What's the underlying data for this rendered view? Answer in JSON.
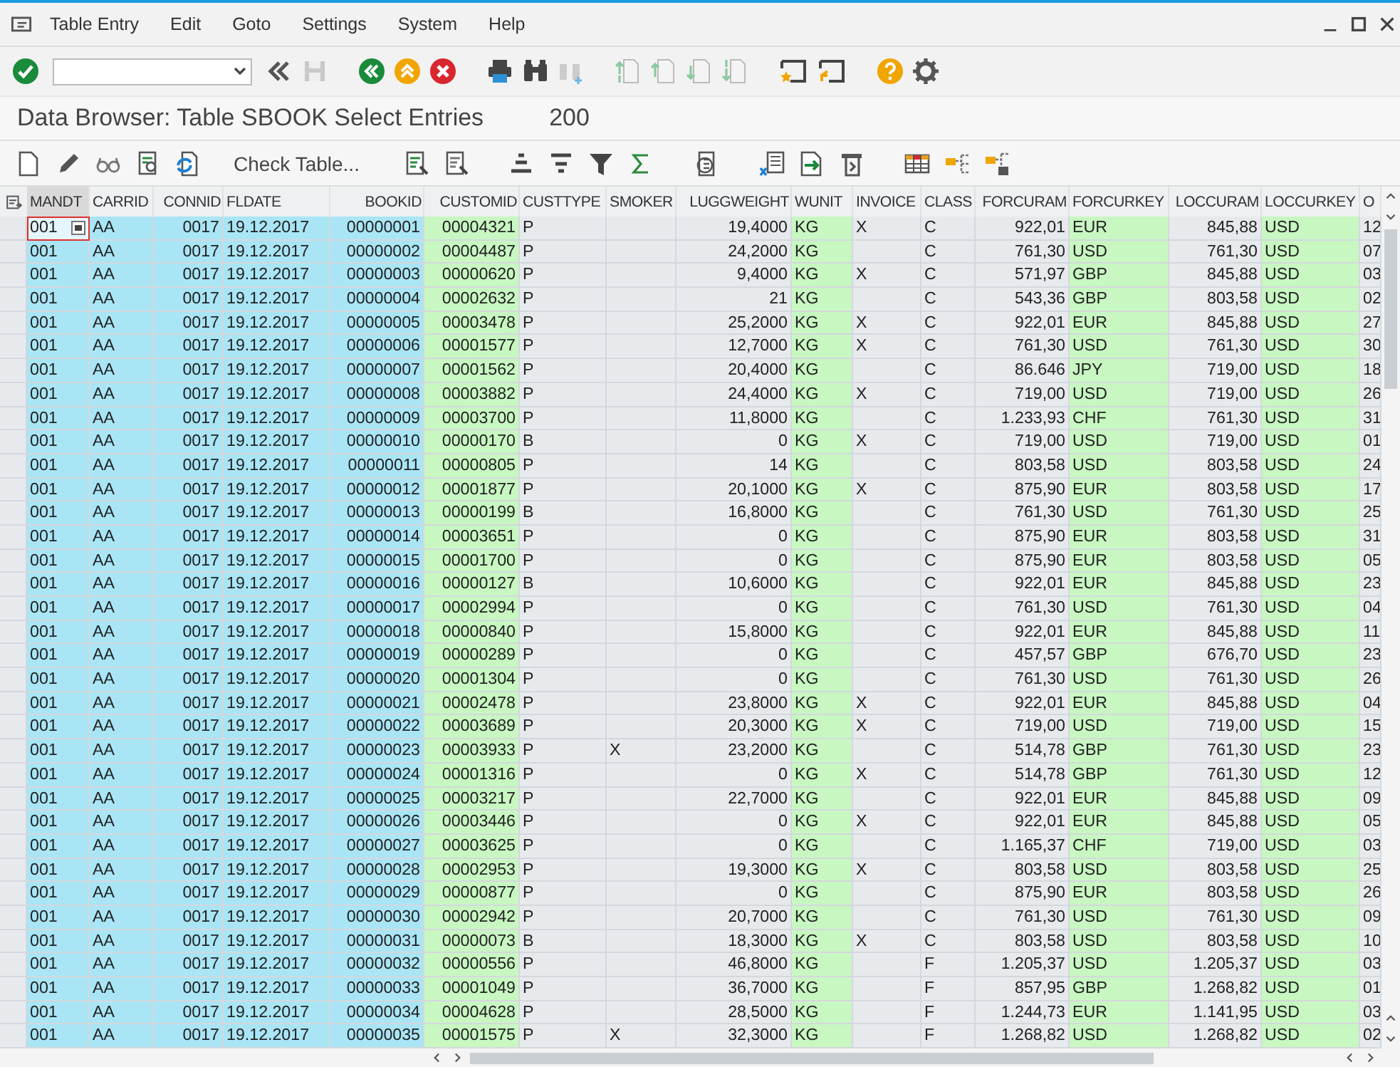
{
  "menu_bar": {
    "items": [
      "Table Entry",
      "Edit",
      "Goto",
      "Settings",
      "System",
      "Help"
    ]
  },
  "title": {
    "text": "Data Browser: Table SBOOK Select Entries",
    "count": "200"
  },
  "app_toolbar": {
    "check_table_button": "Check Table..."
  },
  "table": {
    "columns": [
      {
        "label": "MANDT",
        "kind": "key",
        "numeric": false
      },
      {
        "label": "CARRID",
        "kind": "key",
        "numeric": false
      },
      {
        "label": "CONNID",
        "kind": "key",
        "numeric": true
      },
      {
        "label": "FLDATE",
        "kind": "key",
        "numeric": false
      },
      {
        "label": "BOOKID",
        "kind": "key",
        "numeric": true
      },
      {
        "label": "CUSTOMID",
        "kind": "ref",
        "numeric": true
      },
      {
        "label": "CUSTTYPE",
        "kind": "data",
        "numeric": false
      },
      {
        "label": "SMOKER",
        "kind": "data",
        "numeric": false
      },
      {
        "label": "LUGGWEIGHT",
        "kind": "data",
        "numeric": true
      },
      {
        "label": "WUNIT",
        "kind": "ref",
        "numeric": false
      },
      {
        "label": "INVOICE",
        "kind": "data",
        "numeric": false
      },
      {
        "label": "CLASS",
        "kind": "data",
        "numeric": false
      },
      {
        "label": "FORCURAM",
        "kind": "data",
        "numeric": true
      },
      {
        "label": "FORCURKEY",
        "kind": "ref",
        "numeric": false
      },
      {
        "label": "LOCCURAM",
        "kind": "data",
        "numeric": true
      },
      {
        "label": "LOCCURKEY",
        "kind": "ref",
        "numeric": false
      },
      {
        "label": "O",
        "kind": "data",
        "numeric": false
      }
    ],
    "rows": [
      {
        "focused": true,
        "cells": [
          "001",
          "AA",
          "0017",
          "19.12.2017",
          "00000001",
          "00004321",
          "P",
          null,
          "19,4000",
          "KG",
          "X",
          "C",
          "922,01",
          "EUR",
          "845,88",
          "USD",
          "12"
        ]
      },
      {
        "focused": false,
        "cells": [
          "001",
          "AA",
          "0017",
          "19.12.2017",
          "00000002",
          "00004487",
          "P",
          null,
          "24,2000",
          "KG",
          null,
          "C",
          "761,30",
          "USD",
          "761,30",
          "USD",
          "07"
        ]
      },
      {
        "focused": false,
        "cells": [
          "001",
          "AA",
          "0017",
          "19.12.2017",
          "00000003",
          "00000620",
          "P",
          null,
          "9,4000",
          "KG",
          "X",
          "C",
          "571,97",
          "GBP",
          "845,88",
          "USD",
          "03"
        ]
      },
      {
        "focused": false,
        "cells": [
          "001",
          "AA",
          "0017",
          "19.12.2017",
          "00000004",
          "00002632",
          "P",
          null,
          "21",
          "KG",
          null,
          "C",
          "543,36",
          "GBP",
          "803,58",
          "USD",
          "02"
        ]
      },
      {
        "focused": false,
        "cells": [
          "001",
          "AA",
          "0017",
          "19.12.2017",
          "00000005",
          "00003478",
          "P",
          null,
          "25,2000",
          "KG",
          "X",
          "C",
          "922,01",
          "EUR",
          "845,88",
          "USD",
          "27"
        ]
      },
      {
        "focused": false,
        "cells": [
          "001",
          "AA",
          "0017",
          "19.12.2017",
          "00000006",
          "00001577",
          "P",
          null,
          "12,7000",
          "KG",
          "X",
          "C",
          "761,30",
          "USD",
          "761,30",
          "USD",
          "30"
        ]
      },
      {
        "focused": false,
        "cells": [
          "001",
          "AA",
          "0017",
          "19.12.2017",
          "00000007",
          "00001562",
          "P",
          null,
          "20,4000",
          "KG",
          null,
          "C",
          "86.646",
          "JPY",
          "719,00",
          "USD",
          "18"
        ]
      },
      {
        "focused": false,
        "cells": [
          "001",
          "AA",
          "0017",
          "19.12.2017",
          "00000008",
          "00003882",
          "P",
          null,
          "24,4000",
          "KG",
          "X",
          "C",
          "719,00",
          "USD",
          "719,00",
          "USD",
          "26"
        ]
      },
      {
        "focused": false,
        "cells": [
          "001",
          "AA",
          "0017",
          "19.12.2017",
          "00000009",
          "00003700",
          "P",
          null,
          "11,8000",
          "KG",
          null,
          "C",
          "1.233,93",
          "CHF",
          "761,30",
          "USD",
          "31"
        ]
      },
      {
        "focused": false,
        "cells": [
          "001",
          "AA",
          "0017",
          "19.12.2017",
          "00000010",
          "00000170",
          "B",
          null,
          "0",
          "KG",
          "X",
          "C",
          "719,00",
          "USD",
          "719,00",
          "USD",
          "01"
        ]
      },
      {
        "focused": false,
        "cells": [
          "001",
          "AA",
          "0017",
          "19.12.2017",
          "00000011",
          "00000805",
          "P",
          null,
          "14",
          "KG",
          null,
          "C",
          "803,58",
          "USD",
          "803,58",
          "USD",
          "24"
        ]
      },
      {
        "focused": false,
        "cells": [
          "001",
          "AA",
          "0017",
          "19.12.2017",
          "00000012",
          "00001877",
          "P",
          null,
          "20,1000",
          "KG",
          "X",
          "C",
          "875,90",
          "EUR",
          "803,58",
          "USD",
          "17"
        ]
      },
      {
        "focused": false,
        "cells": [
          "001",
          "AA",
          "0017",
          "19.12.2017",
          "00000013",
          "00000199",
          "B",
          null,
          "16,8000",
          "KG",
          null,
          "C",
          "761,30",
          "USD",
          "761,30",
          "USD",
          "25"
        ]
      },
      {
        "focused": false,
        "cells": [
          "001",
          "AA",
          "0017",
          "19.12.2017",
          "00000014",
          "00003651",
          "P",
          null,
          "0",
          "KG",
          null,
          "C",
          "875,90",
          "EUR",
          "803,58",
          "USD",
          "31"
        ]
      },
      {
        "focused": false,
        "cells": [
          "001",
          "AA",
          "0017",
          "19.12.2017",
          "00000015",
          "00001700",
          "P",
          null,
          "0",
          "KG",
          null,
          "C",
          "875,90",
          "EUR",
          "803,58",
          "USD",
          "05"
        ]
      },
      {
        "focused": false,
        "cells": [
          "001",
          "AA",
          "0017",
          "19.12.2017",
          "00000016",
          "00000127",
          "B",
          null,
          "10,6000",
          "KG",
          null,
          "C",
          "922,01",
          "EUR",
          "845,88",
          "USD",
          "23"
        ]
      },
      {
        "focused": false,
        "cells": [
          "001",
          "AA",
          "0017",
          "19.12.2017",
          "00000017",
          "00002994",
          "P",
          null,
          "0",
          "KG",
          null,
          "C",
          "761,30",
          "USD",
          "761,30",
          "USD",
          "04"
        ]
      },
      {
        "focused": false,
        "cells": [
          "001",
          "AA",
          "0017",
          "19.12.2017",
          "00000018",
          "00000840",
          "P",
          null,
          "15,8000",
          "KG",
          null,
          "C",
          "922,01",
          "EUR",
          "845,88",
          "USD",
          "11"
        ]
      },
      {
        "focused": false,
        "cells": [
          "001",
          "AA",
          "0017",
          "19.12.2017",
          "00000019",
          "00000289",
          "P",
          null,
          "0",
          "KG",
          null,
          "C",
          "457,57",
          "GBP",
          "676,70",
          "USD",
          "23"
        ]
      },
      {
        "focused": false,
        "cells": [
          "001",
          "AA",
          "0017",
          "19.12.2017",
          "00000020",
          "00001304",
          "P",
          null,
          "0",
          "KG",
          null,
          "C",
          "761,30",
          "USD",
          "761,30",
          "USD",
          "26"
        ]
      },
      {
        "focused": false,
        "cells": [
          "001",
          "AA",
          "0017",
          "19.12.2017",
          "00000021",
          "00002478",
          "P",
          null,
          "23,8000",
          "KG",
          "X",
          "C",
          "922,01",
          "EUR",
          "845,88",
          "USD",
          "04"
        ]
      },
      {
        "focused": false,
        "cells": [
          "001",
          "AA",
          "0017",
          "19.12.2017",
          "00000022",
          "00003689",
          "P",
          null,
          "20,3000",
          "KG",
          "X",
          "C",
          "719,00",
          "USD",
          "719,00",
          "USD",
          "15"
        ]
      },
      {
        "focused": false,
        "cells": [
          "001",
          "AA",
          "0017",
          "19.12.2017",
          "00000023",
          "00003933",
          "P",
          "X",
          "23,2000",
          "KG",
          null,
          "C",
          "514,78",
          "GBP",
          "761,30",
          "USD",
          "23"
        ]
      },
      {
        "focused": false,
        "cells": [
          "001",
          "AA",
          "0017",
          "19.12.2017",
          "00000024",
          "00001316",
          "P",
          null,
          "0",
          "KG",
          "X",
          "C",
          "514,78",
          "GBP",
          "761,30",
          "USD",
          "12"
        ]
      },
      {
        "focused": false,
        "cells": [
          "001",
          "AA",
          "0017",
          "19.12.2017",
          "00000025",
          "00003217",
          "P",
          null,
          "22,7000",
          "KG",
          null,
          "C",
          "922,01",
          "EUR",
          "845,88",
          "USD",
          "09"
        ]
      },
      {
        "focused": false,
        "cells": [
          "001",
          "AA",
          "0017",
          "19.12.2017",
          "00000026",
          "00003446",
          "P",
          null,
          "0",
          "KG",
          "X",
          "C",
          "922,01",
          "EUR",
          "845,88",
          "USD",
          "05"
        ]
      },
      {
        "focused": false,
        "cells": [
          "001",
          "AA",
          "0017",
          "19.12.2017",
          "00000027",
          "00003625",
          "P",
          null,
          "0",
          "KG",
          null,
          "C",
          "1.165,37",
          "CHF",
          "719,00",
          "USD",
          "03"
        ]
      },
      {
        "focused": false,
        "cells": [
          "001",
          "AA",
          "0017",
          "19.12.2017",
          "00000028",
          "00002953",
          "P",
          null,
          "19,3000",
          "KG",
          "X",
          "C",
          "803,58",
          "USD",
          "803,58",
          "USD",
          "25"
        ]
      },
      {
        "focused": false,
        "cells": [
          "001",
          "AA",
          "0017",
          "19.12.2017",
          "00000029",
          "00000877",
          "P",
          null,
          "0",
          "KG",
          null,
          "C",
          "875,90",
          "EUR",
          "803,58",
          "USD",
          "26"
        ]
      },
      {
        "focused": false,
        "cells": [
          "001",
          "AA",
          "0017",
          "19.12.2017",
          "00000030",
          "00002942",
          "P",
          null,
          "20,7000",
          "KG",
          null,
          "C",
          "761,30",
          "USD",
          "761,30",
          "USD",
          "09"
        ]
      },
      {
        "focused": false,
        "cells": [
          "001",
          "AA",
          "0017",
          "19.12.2017",
          "00000031",
          "00000073",
          "B",
          null,
          "18,3000",
          "KG",
          "X",
          "C",
          "803,58",
          "USD",
          "803,58",
          "USD",
          "10"
        ]
      },
      {
        "focused": false,
        "cells": [
          "001",
          "AA",
          "0017",
          "19.12.2017",
          "00000032",
          "00000556",
          "P",
          null,
          "46,8000",
          "KG",
          null,
          "F",
          "1.205,37",
          "USD",
          "1.205,37",
          "USD",
          "03"
        ]
      },
      {
        "focused": false,
        "cells": [
          "001",
          "AA",
          "0017",
          "19.12.2017",
          "00000033",
          "00001049",
          "P",
          null,
          "36,7000",
          "KG",
          null,
          "F",
          "857,95",
          "GBP",
          "1.268,82",
          "USD",
          "01"
        ]
      },
      {
        "focused": false,
        "cells": [
          "001",
          "AA",
          "0017",
          "19.12.2017",
          "00000034",
          "00004628",
          "P",
          null,
          "28,5000",
          "KG",
          null,
          "F",
          "1.244,73",
          "EUR",
          "1.141,95",
          "USD",
          "03"
        ]
      },
      {
        "focused": false,
        "cells": [
          "001",
          "AA",
          "0017",
          "19.12.2017",
          "00000035",
          "00001575",
          "P",
          "X",
          "32,3000",
          "KG",
          null,
          "F",
          "1.268,82",
          "USD",
          "1.268,82",
          "USD",
          "02"
        ]
      }
    ]
  }
}
